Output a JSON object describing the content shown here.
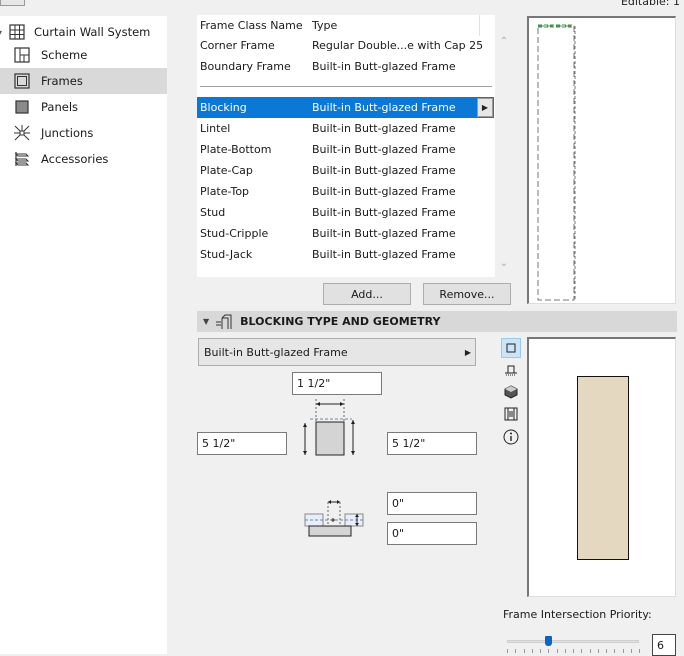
{
  "window": {
    "editable_label": "Editable: 1"
  },
  "sidebar": {
    "root": {
      "label": "Curtain Wall System",
      "icon": "grid-icon",
      "expanded": true
    },
    "items": [
      {
        "label": "Scheme",
        "icon": "scheme-icon",
        "selected": false
      },
      {
        "label": "Frames",
        "icon": "frames-icon",
        "selected": true
      },
      {
        "label": "Panels",
        "icon": "panels-icon",
        "selected": false
      },
      {
        "label": "Junctions",
        "icon": "junctions-icon",
        "selected": false
      },
      {
        "label": "Accessories",
        "icon": "accessories-icon",
        "selected": false
      }
    ]
  },
  "frame_list": {
    "columns": [
      "Frame Class Name",
      "Type"
    ],
    "fixed_rows": [
      {
        "name": "Corner Frame",
        "type": "Regular Double...e with Cap 25"
      },
      {
        "name": "Boundary Frame",
        "type": "Built-in Butt-glazed Frame"
      }
    ],
    "rows": [
      {
        "name": "Blocking",
        "type": "Built-in Butt-glazed Frame",
        "selected": true
      },
      {
        "name": "Lintel",
        "type": "Built-in Butt-glazed Frame"
      },
      {
        "name": "Plate-Bottom",
        "type": "Built-in Butt-glazed Frame"
      },
      {
        "name": "Plate-Cap",
        "type": "Built-in Butt-glazed Frame"
      },
      {
        "name": "Plate-Top",
        "type": "Built-in Butt-glazed Frame"
      },
      {
        "name": "Stud",
        "type": "Built-in Butt-glazed Frame"
      },
      {
        "name": "Stud-Cripple",
        "type": "Built-in Butt-glazed Frame"
      },
      {
        "name": "Stud-Jack",
        "type": "Built-in Butt-glazed Frame"
      }
    ],
    "add_label": "Add...",
    "remove_label": "Remove..."
  },
  "section": {
    "title": "BLOCKING TYPE AND GEOMETRY",
    "type_selector": "Built-in Butt-glazed Frame",
    "width_value": "1 1/2\"",
    "depth_left_value": "5 1/2\"",
    "depth_right_value": "5 1/2\"",
    "offset_value": "0\"",
    "offset2_value": "0\"",
    "view_tools": [
      {
        "icon": "plan-view-icon",
        "active": true
      },
      {
        "icon": "elevation-view-icon",
        "active": false
      },
      {
        "icon": "3d-view-icon",
        "active": false
      },
      {
        "icon": "section-view-icon",
        "active": false
      },
      {
        "icon": "info-icon",
        "active": false
      }
    ],
    "profile_color": "#e4d8c0"
  },
  "priority": {
    "label": "Frame Intersection Priority:",
    "value": "6",
    "slider_fraction": 0.3125
  },
  "colors": {
    "selection": "#0a78d4",
    "slider_thumb": "#0a66c2"
  }
}
